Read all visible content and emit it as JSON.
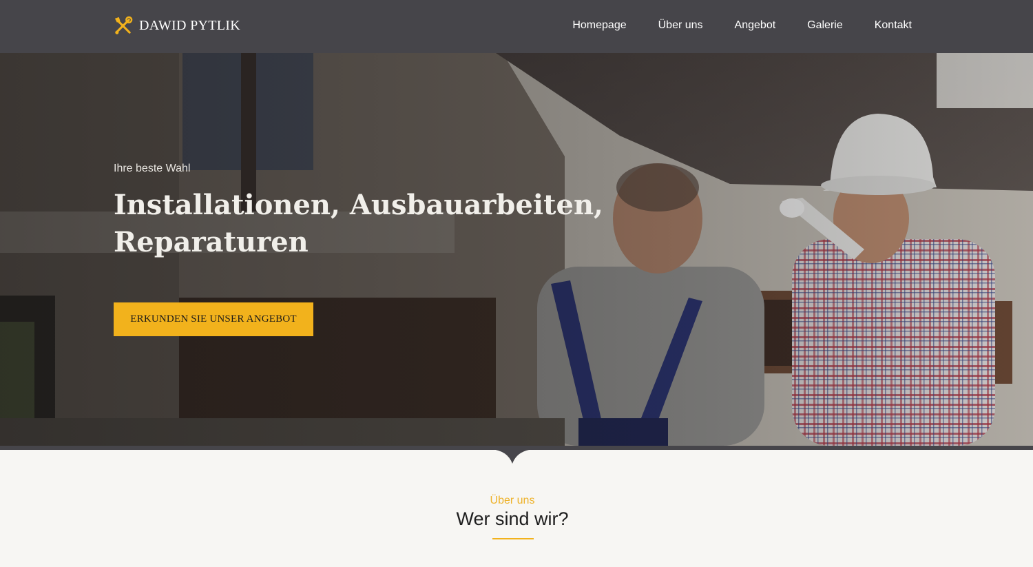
{
  "header": {
    "logo_text": "DAWID PYTLIK",
    "logo_icon": "tools-icon",
    "nav": [
      {
        "label": "Homepage"
      },
      {
        "label": "Über uns"
      },
      {
        "label": "Angebot"
      },
      {
        "label": "Galerie"
      },
      {
        "label": "Kontakt"
      }
    ]
  },
  "hero": {
    "kicker": "Ihre beste Wahl",
    "title": "Installationen, Ausbauarbeiten, Reparaturen",
    "button_label": "ERKUNDEN SIE UNSER ANGEBOT"
  },
  "about": {
    "kicker": "Über uns",
    "title": "Wer sind wir?"
  },
  "colors": {
    "header_bg": "#46454a",
    "accent": "#f2b21c",
    "section_bg": "#f7f6f3"
  }
}
